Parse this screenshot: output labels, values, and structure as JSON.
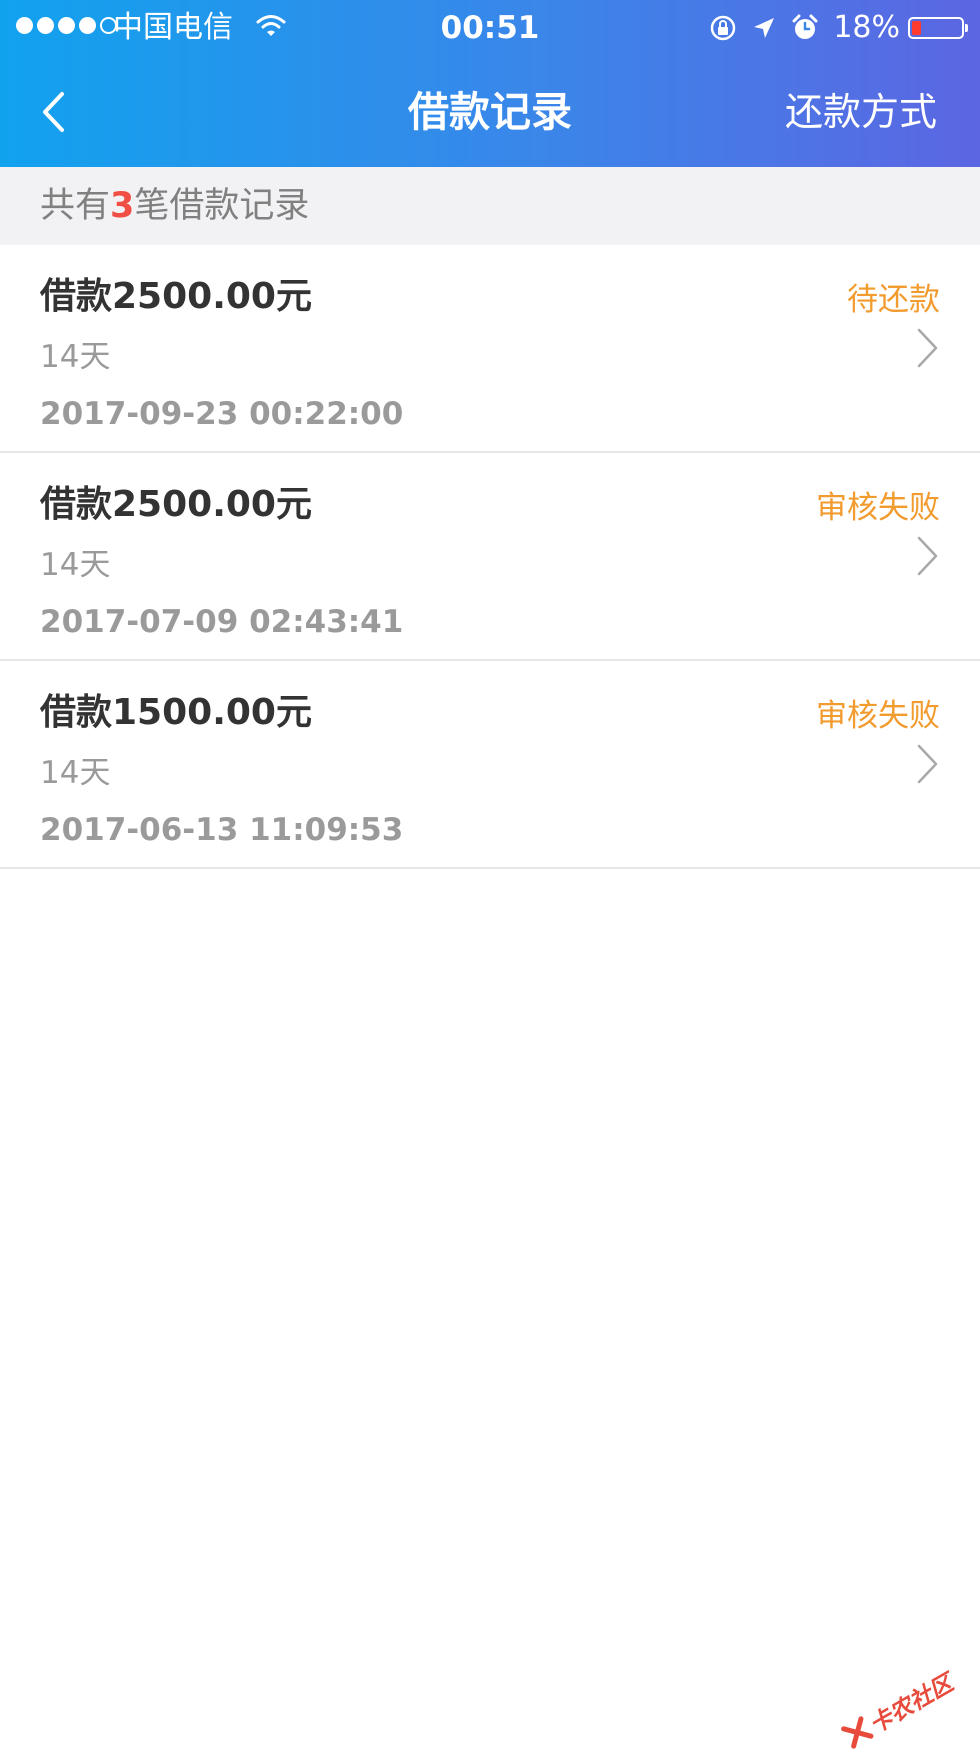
{
  "status_bar": {
    "carrier": "中国电信",
    "time": "00:51",
    "battery": "18%",
    "battery_level": 0.18
  },
  "nav": {
    "title": "借款记录",
    "right_action": "还款方式"
  },
  "summary": {
    "prefix": "共有",
    "count": "3",
    "suffix": "笔借款记录"
  },
  "records": [
    {
      "amount": "借款2500.00元",
      "period": "14天",
      "datetime": "2017-09-23 00:22:00",
      "status": "待还款"
    },
    {
      "amount": "借款2500.00元",
      "period": "14天",
      "datetime": "2017-07-09 02:43:41",
      "status": "审核失败"
    },
    {
      "amount": "借款1500.00元",
      "period": "14天",
      "datetime": "2017-06-13 11:09:53",
      "status": "审核失败"
    }
  ],
  "watermark": "卡农社区",
  "colors": {
    "header_gradient_start": "#11a2ee",
    "header_gradient_end": "#5c66e2",
    "status_text": "#f29b2e",
    "count_highlight": "#f24f44"
  }
}
